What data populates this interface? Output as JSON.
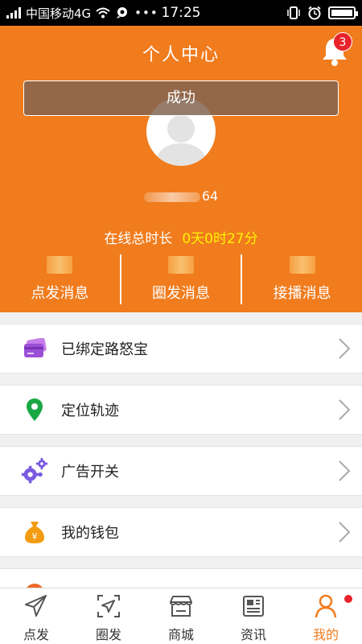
{
  "status_bar": {
    "carrier": "中国移动4G",
    "time": "17:25"
  },
  "header": {
    "title": "个人中心",
    "notification_count": "3",
    "toast": "成功",
    "username_suffix": "64",
    "online_label": "在线总时长",
    "online_value": "0天0时27分",
    "stats": [
      {
        "label": "点发消息"
      },
      {
        "label": "圈发消息"
      },
      {
        "label": "接播消息"
      }
    ]
  },
  "menu": {
    "items": [
      {
        "label": "已绑定路怒宝",
        "icon": "card-icon"
      },
      {
        "label": "定位轨迹",
        "icon": "location-pin-icon"
      },
      {
        "label": "广告开关",
        "icon": "gears-icon"
      },
      {
        "label": "我的钱包",
        "icon": "money-bag-icon"
      }
    ]
  },
  "tabbar": {
    "tabs": [
      {
        "label": "点发",
        "icon": "paper-plane-icon"
      },
      {
        "label": "圈发",
        "icon": "circle-send-icon"
      },
      {
        "label": "商城",
        "icon": "shop-icon"
      },
      {
        "label": "资讯",
        "icon": "newspaper-icon"
      },
      {
        "label": "我的",
        "icon": "person-icon"
      }
    ],
    "active_index": 4
  },
  "colors": {
    "accent": "#f07c1e",
    "badge": "#e8232b",
    "highlight": "#fff200"
  }
}
